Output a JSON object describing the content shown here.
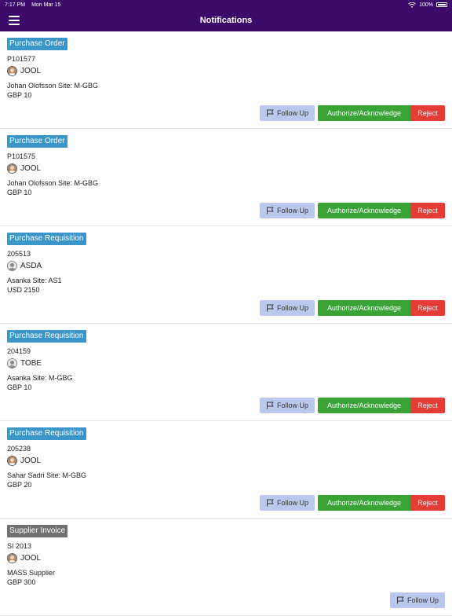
{
  "status": {
    "time": "7:17 PM",
    "date": "Mon Mar 15",
    "battery": "100%"
  },
  "header": {
    "title": "Notifications",
    "menu_icon": "hamburger-icon"
  },
  "colors": {
    "header_bg": "#3b0a6b",
    "purchase_badge": "#3a95c9",
    "supplier_badge": "#707070",
    "follow_up": "#b9c9ee",
    "authorize": "#3aa336",
    "reject": "#e63c36"
  },
  "notifications": [
    {
      "type": "Purchase Order",
      "doc_id": "P101577",
      "user": "JOOL",
      "site": "Johan Olofsson Site: M-GBG",
      "amount": "GBP 10"
    },
    {
      "type": "Purchase Order",
      "doc_id": "P101575",
      "user": "JOOL",
      "site": "Johan Olofsson Site: M-GBG",
      "amount": "GBP 10"
    },
    {
      "type": "Purchase Requisition",
      "doc_id": "205513",
      "user": "ASDA",
      "site": "Asanka Site: AS1",
      "amount": "USD 2150"
    },
    {
      "type": "Purchase Requisition",
      "doc_id": "204159",
      "user": "TOBE",
      "site": "Asanka Site: M-GBG",
      "amount": "GBP 10"
    },
    {
      "type": "Purchase Requisition",
      "doc_id": "205238",
      "user": "JOOL",
      "site": "Sahar Sadri Site: M-GBG",
      "amount": "GBP 20"
    },
    {
      "type": "Supplier Invoice",
      "doc_id": "SI 2013",
      "user": "JOOL",
      "site": "MASS Supplier",
      "amount": "GBP 300"
    }
  ],
  "actions": {
    "follow_up": "Follow Up",
    "authorize": "Authorize/Acknowledge",
    "reject": "Reject"
  }
}
